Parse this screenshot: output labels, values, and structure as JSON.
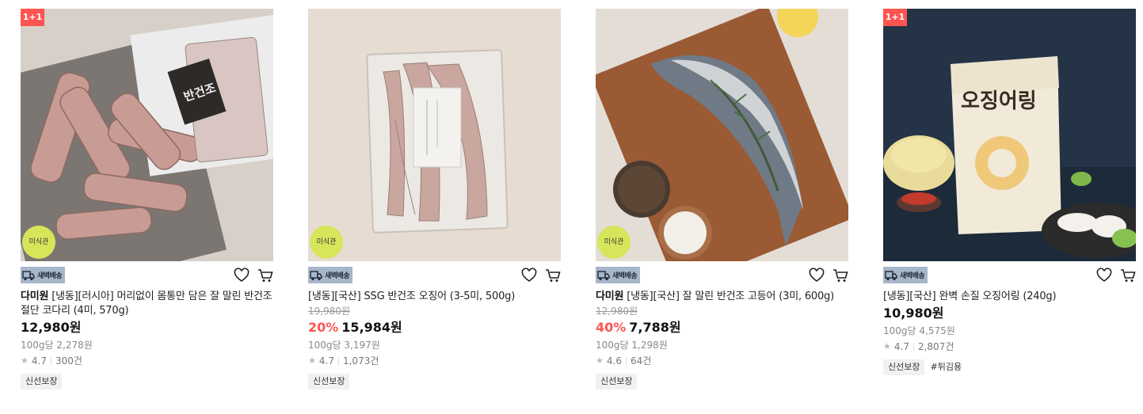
{
  "products": [
    {
      "badge": "1+1",
      "sticker": "미식관",
      "dawn_label": "새벽배송",
      "brand": "다미원",
      "name": "[냉동][러시아] 머리없이 몸통만 담은 잘 말린 반건조 절단 코다리 (4미, 570g)",
      "discount": "",
      "original_price": "",
      "price": "12,980원",
      "unit_price": "100g당 2,278원",
      "rating": "4.7",
      "review_count": "300건",
      "chips": [
        "신선보장"
      ],
      "image_icon": "dried-pollack-photo"
    },
    {
      "badge": "",
      "sticker": "미식관",
      "dawn_label": "새벽배송",
      "brand": "",
      "name": "[냉동][국산] SSG 반건조 오징어 (3-5미, 500g)",
      "discount": "20%",
      "original_price": "19,980원",
      "price": "15,984원",
      "unit_price": "100g당 3,197원",
      "rating": "4.7",
      "review_count": "1,073건",
      "chips": [
        "신선보장"
      ],
      "image_icon": "dried-squid-package-photo"
    },
    {
      "badge": "",
      "sticker": "미식관",
      "dawn_label": "새벽배송",
      "brand": "다미원",
      "name": "[냉동][국산] 잘 말린 반건조 고등어 (3미, 600g)",
      "discount": "40%",
      "original_price": "12,980원",
      "price": "7,788원",
      "unit_price": "100g당 1,298원",
      "rating": "4.6",
      "review_count": "64건",
      "chips": [
        "신선보장"
      ],
      "image_icon": "mackerel-photo"
    },
    {
      "badge": "1+1",
      "sticker": "",
      "dawn_label": "새벽배송",
      "brand": "",
      "name": "[냉동][국산] 완벽 손질 오징어링 (240g)",
      "discount": "",
      "original_price": "",
      "price": "10,980원",
      "unit_price": "100g당 4,575원",
      "rating": "4.7",
      "review_count": "2,807건",
      "chips": [
        "신선보장",
        "#튀김용"
      ],
      "image_icon": "squid-ring-package-photo"
    }
  ],
  "package_text": "오징어링",
  "colors": {
    "badge": "#ff5452",
    "discount": "#ff5452",
    "sticker": "#d7e55a",
    "dawn": "#a7b6c8"
  }
}
